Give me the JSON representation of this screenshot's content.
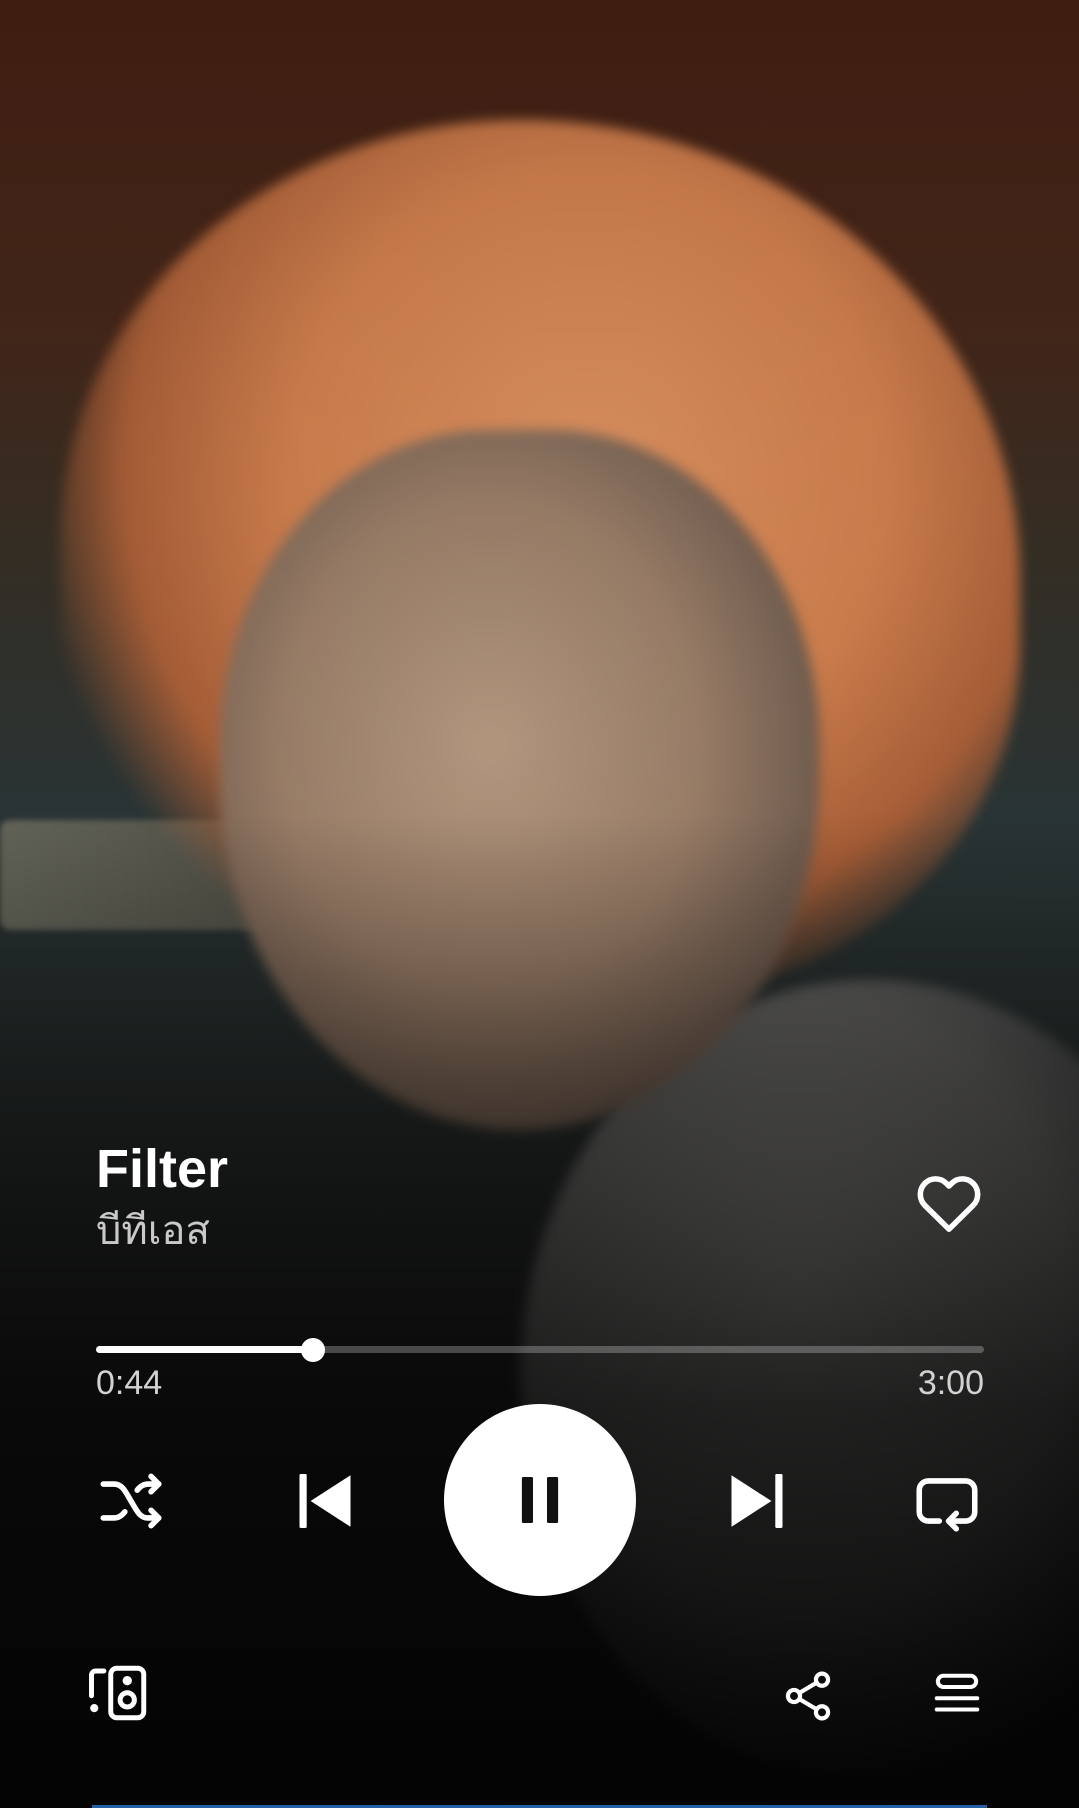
{
  "track": {
    "title": "Filter",
    "artist": "บีทีเอส",
    "liked": false
  },
  "playback": {
    "elapsed": "0:44",
    "duration": "3:00",
    "progress_fraction": 0.244,
    "state": "playing"
  },
  "controls": {
    "shuffle_icon": "shuffle-icon",
    "previous_icon": "skip-previous-icon",
    "play_pause_icon": "pause-icon",
    "next_icon": "skip-next-icon",
    "repeat_icon": "repeat-icon",
    "like_icon": "heart-outline-icon",
    "devices_icon": "devices-icon",
    "share_icon": "share-icon",
    "queue_icon": "queue-icon"
  },
  "colors": {
    "accent_play_button": "#ffffff",
    "progress_fill": "#ffffff",
    "artist_text": "#c9c9c9"
  }
}
